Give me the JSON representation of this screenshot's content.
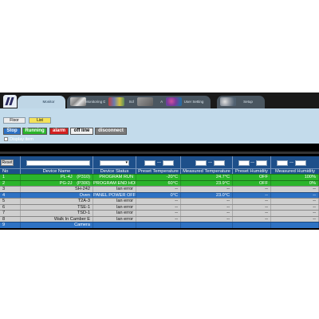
{
  "tabs": [
    {
      "label": "Monitor",
      "icon": "monitor-icon",
      "active": true
    },
    {
      "label": "Monitoring Data",
      "icon": "data-chart-icon",
      "active": false
    },
    {
      "label": "Schedule",
      "icon": "schedule-icon",
      "active": false
    },
    {
      "label": "Alarm",
      "icon": "alarm-icon",
      "active": false
    },
    {
      "label": "User Setting",
      "icon": "user-setting-icon",
      "active": false
    },
    {
      "label": "Setup",
      "icon": "setup-tools-icon",
      "active": false
    }
  ],
  "view_buttons": {
    "floor": "Floor",
    "list": "List"
  },
  "status_filters": {
    "stop": "Stop",
    "running": "Running",
    "alarm": "alarm",
    "offline": "off line",
    "disconnect": "disconnect"
  },
  "display_item": "Display item",
  "reset": "Reset",
  "filter_dash": "—",
  "columns": [
    "No",
    "Device Name",
    "Device Status",
    "Preset Temperature",
    "Measured Temperature",
    "Preset Humidity",
    "Measured Humidity"
  ],
  "rows": [
    {
      "no": "1",
      "name": "PL-4J　(P310)",
      "status": "PROGRAM RUN",
      "preset_temp": "-20°C",
      "meas_temp": "24.7°C",
      "preset_hum": "OFF",
      "meas_hum": "100%",
      "row_color": "#2bb52b",
      "text_color": "#ffffff"
    },
    {
      "no": "2",
      "name": "PG-2J　(P300)",
      "status": "PROGRAM END HOLD",
      "preset_temp": "60°C",
      "meas_temp": "23.9°C",
      "preset_hum": "OFF",
      "meas_hum": "0%",
      "row_color": "#2bb52b",
      "text_color": "#ffffff"
    },
    {
      "no": "3",
      "name": "SH-242",
      "status": "lan error",
      "preset_temp": "--",
      "meas_temp": "--",
      "preset_hum": "--",
      "meas_hum": "--",
      "row_color": "#cfcfcf",
      "text_color": "#111111"
    },
    {
      "no": "4",
      "name": "Oven",
      "status": "PANEL POWER OFF",
      "preset_temp": "0°C",
      "meas_temp": "23.0°C",
      "preset_hum": "--",
      "meas_hum": "--",
      "row_color": "#2e72c4",
      "text_color": "#ffffff"
    },
    {
      "no": "5",
      "name": "T2A-3",
      "status": "lan error",
      "preset_temp": "--",
      "meas_temp": "--",
      "preset_hum": "--",
      "meas_hum": "--",
      "row_color": "#cfcfcf",
      "text_color": "#111111"
    },
    {
      "no": "6",
      "name": "TSE-1",
      "status": "lan error",
      "preset_temp": "--",
      "meas_temp": "--",
      "preset_hum": "--",
      "meas_hum": "--",
      "row_color": "#cfcfcf",
      "text_color": "#111111"
    },
    {
      "no": "7",
      "name": "TSD-1",
      "status": "lan error",
      "preset_temp": "--",
      "meas_temp": "--",
      "preset_hum": "--",
      "meas_hum": "--",
      "row_color": "#cfcfcf",
      "text_color": "#111111"
    },
    {
      "no": "8",
      "name": "Walk In Camber E",
      "status": "lan error",
      "preset_temp": "--",
      "meas_temp": "--",
      "preset_hum": "--",
      "meas_hum": "--",
      "row_color": "#cfcfcf",
      "text_color": "#111111"
    },
    {
      "no": "9",
      "name": "Camera",
      "status": "",
      "preset_temp": "",
      "meas_temp": "",
      "preset_hum": "",
      "meas_hum": "",
      "row_color": "#2e72c4",
      "text_color": "#ffffff"
    }
  ],
  "colors": {
    "running": "#2bb52b",
    "stop": "#2e72c4",
    "alarm": "#d42020",
    "offline": "#f0f0f0",
    "disconnect": "#7a7a7a",
    "lan_error": "#cfcfcf",
    "header": "#1d4f8a"
  }
}
